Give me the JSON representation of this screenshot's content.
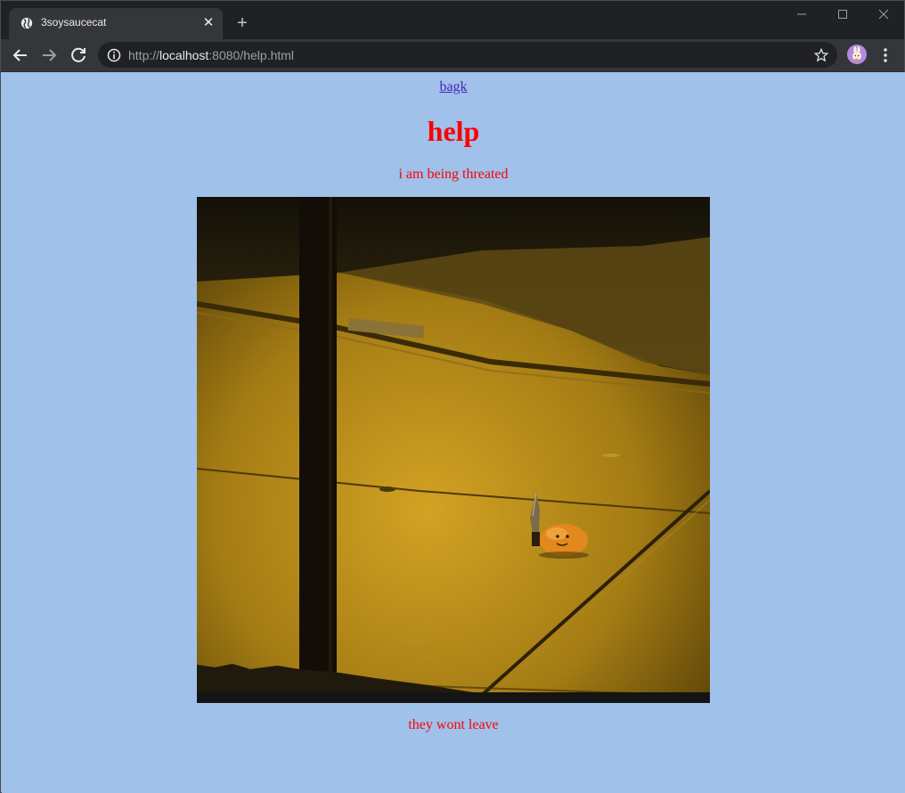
{
  "browser": {
    "tab_title": "3soysaucecat",
    "url_scheme": "http://",
    "url_host": "localhost",
    "url_rest": ":8080/help.html"
  },
  "icons": {
    "favicon": "globe-icon",
    "close": "close-icon",
    "new_tab": "plus-icon",
    "back": "back-arrow-icon",
    "forward": "forward-arrow-icon",
    "reload": "reload-icon",
    "info": "info-icon",
    "bookmark": "star-icon",
    "profile": "avatar",
    "menu": "kebab-menu-icon"
  },
  "page": {
    "back_link": "bagk",
    "title": "help",
    "subtitle": "i am being threated",
    "caption": "they wont leave"
  },
  "colors": {
    "background": "#9fc1ea",
    "text": "#ff0000",
    "link": "#4a23b8"
  }
}
